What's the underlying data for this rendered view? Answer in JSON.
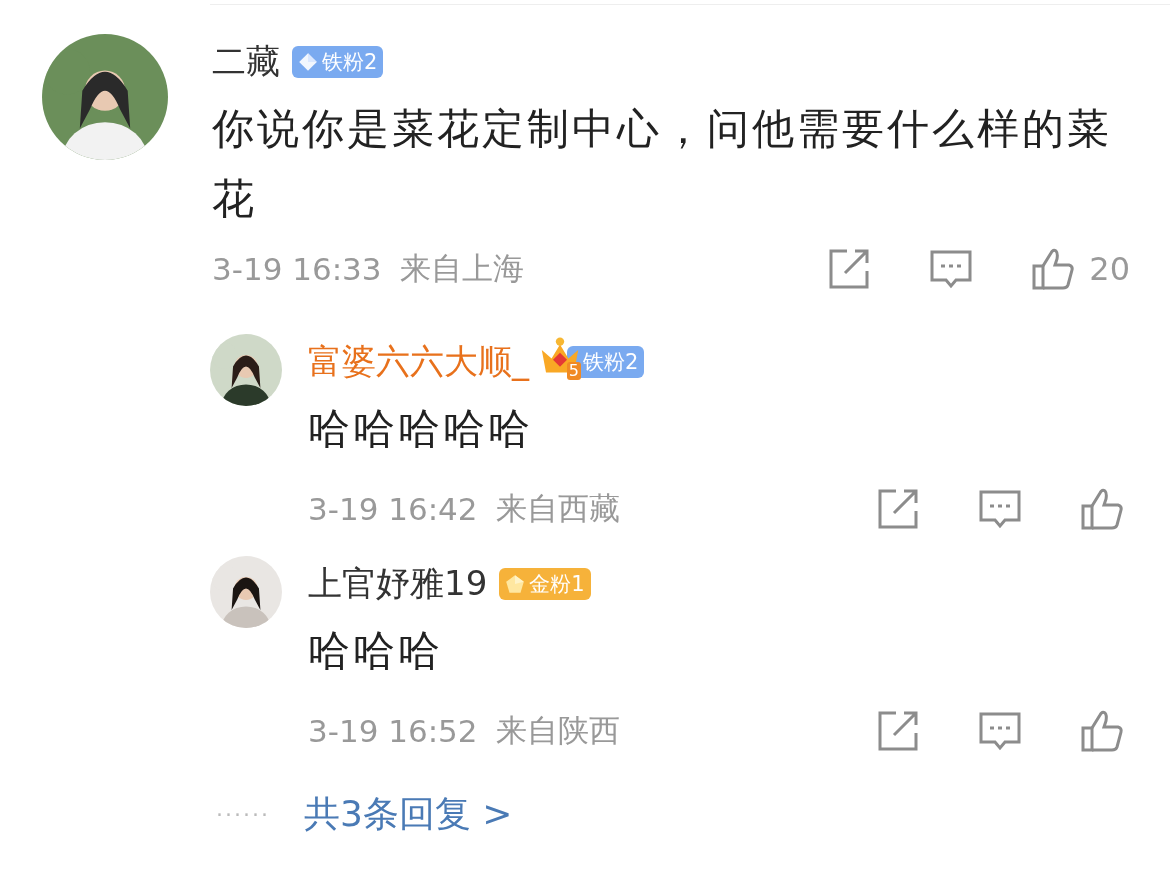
{
  "comment": {
    "name": "二藏",
    "vip": false,
    "badge": {
      "kind": "iron",
      "label": "铁粉2"
    },
    "text": "你说你是菜花定制中心，问他需要什么样的菜花",
    "time": "3-19 16:33",
    "location": "来自上海",
    "likes": "20"
  },
  "replies": [
    {
      "name": "富婆六六大顺_",
      "vip": true,
      "crown_level": "5",
      "badge": {
        "kind": "iron",
        "label": "铁粉2"
      },
      "text": "哈哈哈哈哈",
      "time": "3-19 16:42",
      "location": "来自西藏"
    },
    {
      "name": "上官妤雅19",
      "vip": false,
      "badge": {
        "kind": "gold",
        "label": "金粉1"
      },
      "text": "哈哈哈",
      "time": "3-19 16:52",
      "location": "来自陕西"
    }
  ],
  "more_replies": "共3条回复 >",
  "dots": "······"
}
